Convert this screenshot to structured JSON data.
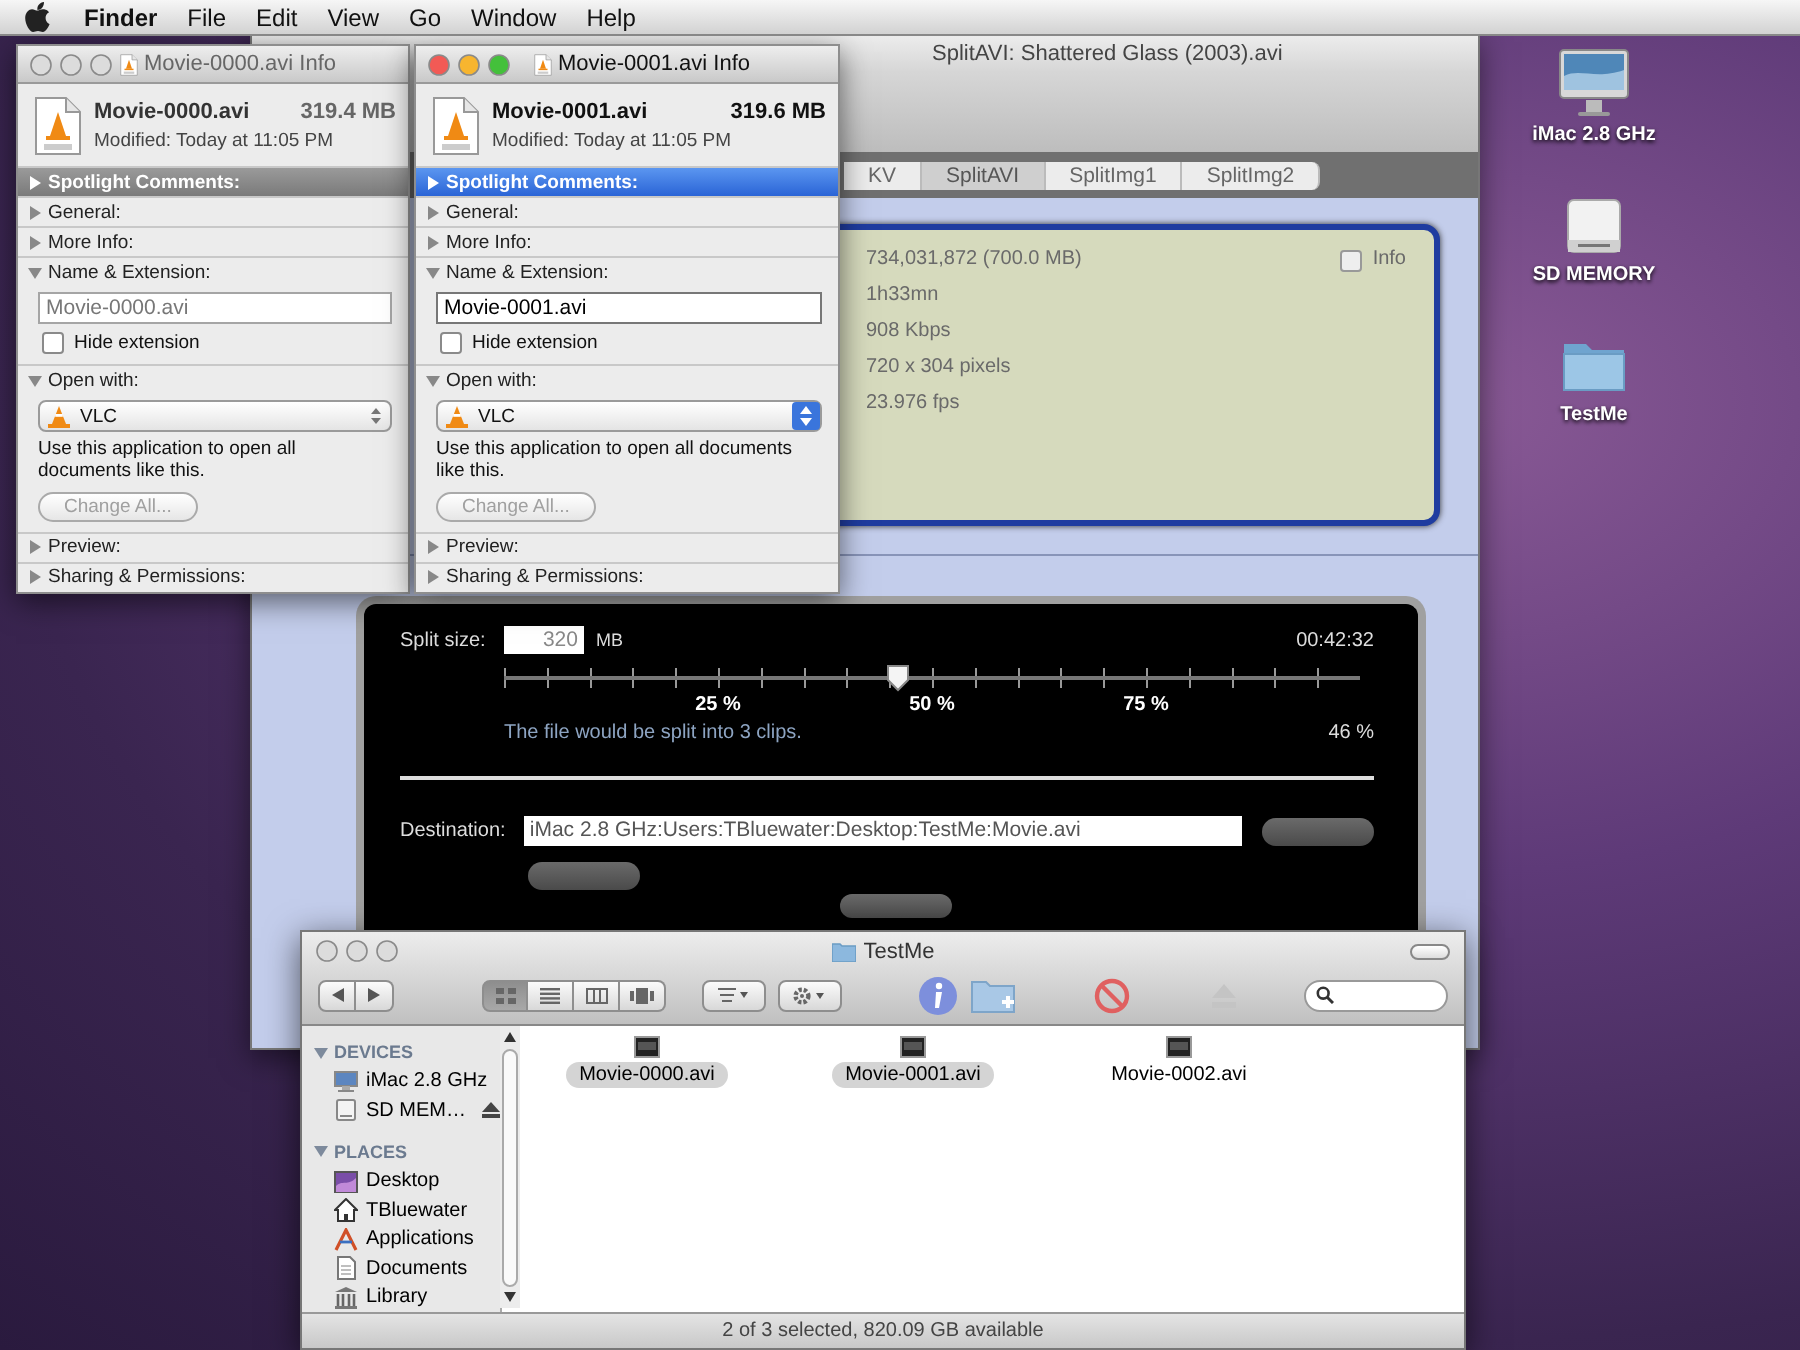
{
  "menu_bar": {
    "app": "Finder",
    "menus": [
      "File",
      "Edit",
      "View",
      "Go",
      "Window",
      "Help"
    ]
  },
  "desktop_icons": [
    {
      "label": "iMac 2.8 GHz",
      "kind": "computer"
    },
    {
      "label": "SD MEMORY",
      "kind": "drive"
    },
    {
      "label": "TestMe",
      "kind": "folder"
    }
  ],
  "splitavi_window": {
    "title": "SplitAVI: Shattered Glass (2003).avi",
    "tabs": [
      {
        "label": "KV",
        "selected": false
      },
      {
        "label": "SplitAVI",
        "selected": true
      },
      {
        "label": "SplitImg1",
        "selected": false
      },
      {
        "label": "SplitImg2",
        "selected": false
      }
    ],
    "file_info": [
      "734,031,872 (700.0 MB)",
      "1h33mn",
      "908 Kbps",
      "720 x 304 pixels",
      "23.976 fps"
    ],
    "info_checkbox": {
      "label": "Info",
      "checked": false
    },
    "split": {
      "label": "Split size:",
      "size": "320",
      "unit": "MB",
      "duration": "00:42:32",
      "slider": {
        "level": 0.46,
        "tick_labels": [
          "25 %",
          "50 %",
          "75 %"
        ]
      },
      "message": "The file would be split into 3 clips.",
      "percent": "46 %",
      "destination_label": "Destination:",
      "destination": "iMac 2.8 GHz:Users:TBluewater:Desktop:TestMe:Movie.avi"
    }
  },
  "info_windows": [
    {
      "title": "Movie-0000.avi Info",
      "active": false,
      "file_name": "Movie-0000.avi",
      "size": "319.4 MB",
      "modified": "Modified: Today at 11:05 PM",
      "sections": [
        {
          "label": "Spotlight Comments:",
          "expanded": false,
          "selected": true
        },
        {
          "label": "General:",
          "expanded": false,
          "selected": false
        },
        {
          "label": "More Info:",
          "expanded": false,
          "selected": false
        },
        {
          "label": "Name & Extension:",
          "kind": "name",
          "expanded": true,
          "selected": false,
          "value": "Movie-0000.avi",
          "hide_extension": {
            "label": "Hide extension",
            "checked": false
          }
        },
        {
          "label": "Open with:",
          "kind": "open_with",
          "expanded": true,
          "selected": false,
          "app": "VLC",
          "note": "Use this application to open all documents like this.",
          "button": {
            "label": "Change All...",
            "disabled": true
          }
        },
        {
          "label": "Preview:",
          "expanded": false,
          "selected": false
        },
        {
          "label": "Sharing & Permissions:",
          "expanded": false,
          "selected": false
        }
      ]
    },
    {
      "title": "Movie-0001.avi Info",
      "active": true,
      "file_name": "Movie-0001.avi",
      "size": "319.6 MB",
      "modified": "Modified: Today at 11:05 PM",
      "sections": [
        {
          "label": "Spotlight Comments:",
          "expanded": false,
          "selected": true
        },
        {
          "label": "General:",
          "expanded": false,
          "selected": false
        },
        {
          "label": "More Info:",
          "expanded": false,
          "selected": false
        },
        {
          "label": "Name & Extension:",
          "kind": "name",
          "expanded": true,
          "selected": false,
          "value": "Movie-0001.avi",
          "hide_extension": {
            "label": "Hide extension",
            "checked": false
          }
        },
        {
          "label": "Open with:",
          "kind": "open_with",
          "expanded": true,
          "selected": false,
          "app": "VLC",
          "note": "Use this application to open all documents like this.",
          "button": {
            "label": "Change All...",
            "disabled": true
          }
        },
        {
          "label": "Preview:",
          "expanded": false,
          "selected": false
        },
        {
          "label": "Sharing & Permissions:",
          "expanded": false,
          "selected": false
        }
      ]
    }
  ],
  "finder_window": {
    "title": "TestMe",
    "view_modes": [
      {
        "kind": "icon",
        "selected": true
      },
      {
        "kind": "list",
        "selected": false
      },
      {
        "kind": "column",
        "selected": false
      },
      {
        "kind": "coverflow",
        "selected": false
      }
    ],
    "sidebar": [
      {
        "heading": "DEVICES",
        "expanded": true,
        "items": [
          {
            "label": "iMac 2.8 GHz",
            "kind": "computer"
          },
          {
            "label": "SD MEM…",
            "kind": "drive"
          }
        ]
      },
      {
        "heading": "PLACES",
        "expanded": true,
        "items": [
          {
            "label": "Desktop",
            "kind": "desktop"
          },
          {
            "label": "TBluewater",
            "kind": "home"
          },
          {
            "label": "Applications",
            "kind": "applications"
          },
          {
            "label": "Documents",
            "kind": "documents"
          },
          {
            "label": "Library",
            "kind": "library"
          }
        ]
      }
    ],
    "files": [
      {
        "name": "Movie-0000.avi",
        "selected": true
      },
      {
        "name": "Movie-0001.avi",
        "selected": true
      },
      {
        "name": "Movie-0002.avi",
        "selected": false
      }
    ],
    "status": "2 of 3 selected, 820.09 GB available"
  }
}
